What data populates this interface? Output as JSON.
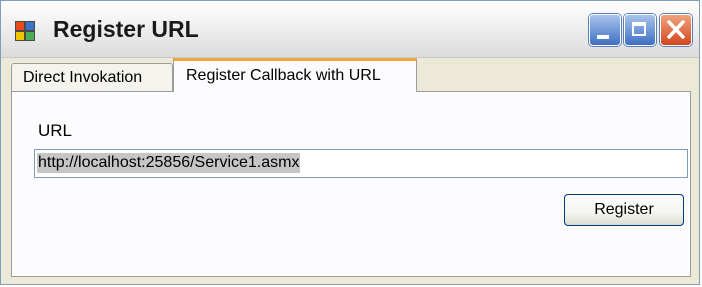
{
  "window": {
    "title": "Register URL",
    "icon": "windows-forms-app-icon",
    "controls": [
      "minimize-icon",
      "maximize-icon",
      "close-icon"
    ]
  },
  "tabs": [
    {
      "label": "Direct Invokation",
      "active": false
    },
    {
      "label": "Register Callback with URL",
      "active": true
    }
  ],
  "form": {
    "url_label": "URL",
    "url_value": "http://localhost:25856/Service1.asmx",
    "url_selected": true,
    "register_label": "Register"
  },
  "colors": {
    "active_tab_accent": "#f2a83b",
    "selection_bg": "#c6c6c6",
    "close_button": "#d2461e",
    "caption_button": "#3f6fc4"
  }
}
